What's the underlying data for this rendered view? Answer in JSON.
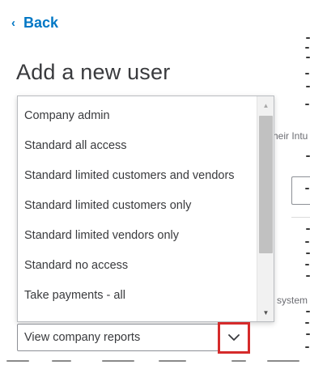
{
  "back": {
    "label": "Back"
  },
  "page": {
    "title": "Add a new user"
  },
  "role_dropdown": {
    "options": [
      "Company admin",
      "Standard all access",
      "Standard limited customers and vendors",
      "Standard limited customers only",
      "Standard limited vendors only",
      "Standard no access",
      "Take payments - all"
    ],
    "selected_value": "View company reports"
  },
  "background": {
    "partial_text_1": "heir Intu",
    "partial_text_2": "system"
  },
  "colors": {
    "link": "#0077c5",
    "highlight_box": "#d52b2b",
    "text": "#393a3d"
  },
  "icons": {
    "back": "chevron-left-icon",
    "toggle": "chevron-down-icon",
    "scroll_up": "triangle-up-icon",
    "scroll_down": "triangle-down-icon"
  }
}
